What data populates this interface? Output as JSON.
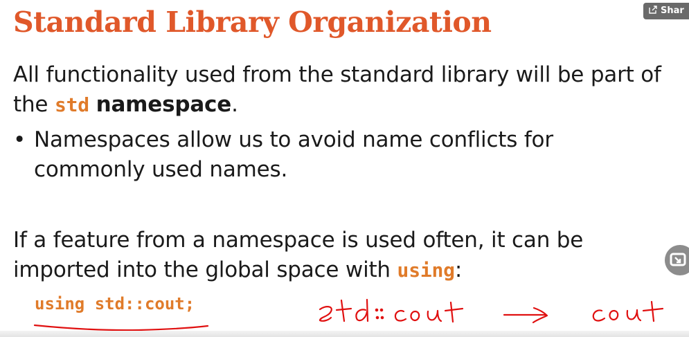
{
  "slide": {
    "title": "Standard Library Organization",
    "para1_prefix": "All functionality used from the standard library will be part of the ",
    "para1_code": "std",
    "para1_bold": "namespace",
    "para1_suffix": ".",
    "bullet_symbol": "•",
    "bullet_text": "Namespaces allow us to avoid name conflicts for commonly used names.",
    "para3_prefix": "If a feature from a namespace is used often, it can be imported into the global space with ",
    "para3_code": "using",
    "para3_suffix": ":",
    "code_line": "using std::cout;"
  },
  "annotations": {
    "handwritten_left": "std::cout",
    "arrow": "→",
    "handwritten_right": "cout",
    "ink_color": "#e01010"
  },
  "overlay": {
    "share_label": "Shar",
    "share_icon": "share-icon",
    "float_icon": "screen-exit-icon"
  },
  "colors": {
    "title": "#e0582a",
    "code": "#e07b2a",
    "text": "#1a1a1a"
  }
}
